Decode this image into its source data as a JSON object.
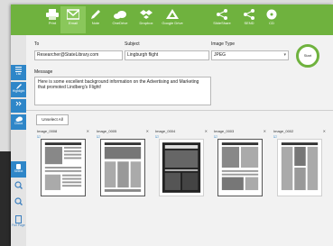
{
  "toolbar": {
    "items": [
      {
        "label": "Print",
        "icon": "printer-icon"
      },
      {
        "label": "Email",
        "icon": "envelope-icon"
      },
      {
        "label": "Note",
        "icon": "pencil-icon"
      },
      {
        "label": "OneDrive",
        "icon": "cloud-icon"
      },
      {
        "label": "Dropbox",
        "icon": "dropbox-icon"
      },
      {
        "label": "Google Drive",
        "icon": "google-drive-icon"
      },
      {
        "label": "SlideShare",
        "icon": "share-icon"
      },
      {
        "label": "SEND",
        "icon": "share-icon"
      },
      {
        "label": "CD",
        "icon": "disc-icon"
      }
    ],
    "active": "Email"
  },
  "sidebar": {
    "items": [
      {
        "label": "List",
        "icon": "list-icon"
      },
      {
        "label": "Highlight",
        "icon": "highlight-icon"
      },
      {
        "label": "",
        "icon": "arrows-icon"
      },
      {
        "label": "Cloud",
        "icon": "cloud-icon"
      },
      {
        "label": "Select",
        "icon": "hand-icon"
      },
      {
        "label": "",
        "icon": "zoom-in-icon"
      },
      {
        "label": "",
        "icon": "zoom-out-icon"
      },
      {
        "label": "Full Page",
        "icon": "page-icon"
      }
    ]
  },
  "form": {
    "to_label": "To",
    "to_value": "Researcher@StateLibrary.com",
    "subject_label": "Subject",
    "subject_value": "Lingburgh flight",
    "image_type_label": "Image Type",
    "image_type_value": "JPEG",
    "message_label": "Message",
    "message_value": "Here is some excellent background information on the Advertising and Marketing that promoted Lindberg's Flight!",
    "start_label": "Start"
  },
  "unselect_all_label": "Unselect All",
  "thumbnails": [
    {
      "name": "Image_0008"
    },
    {
      "name": "Image_0005"
    },
    {
      "name": "Image_0004"
    },
    {
      "name": "Image_0003"
    },
    {
      "name": "Image_0002"
    }
  ],
  "colors": {
    "toolbar": "#6fb23e",
    "sidebar_accent": "#2e86c8"
  }
}
